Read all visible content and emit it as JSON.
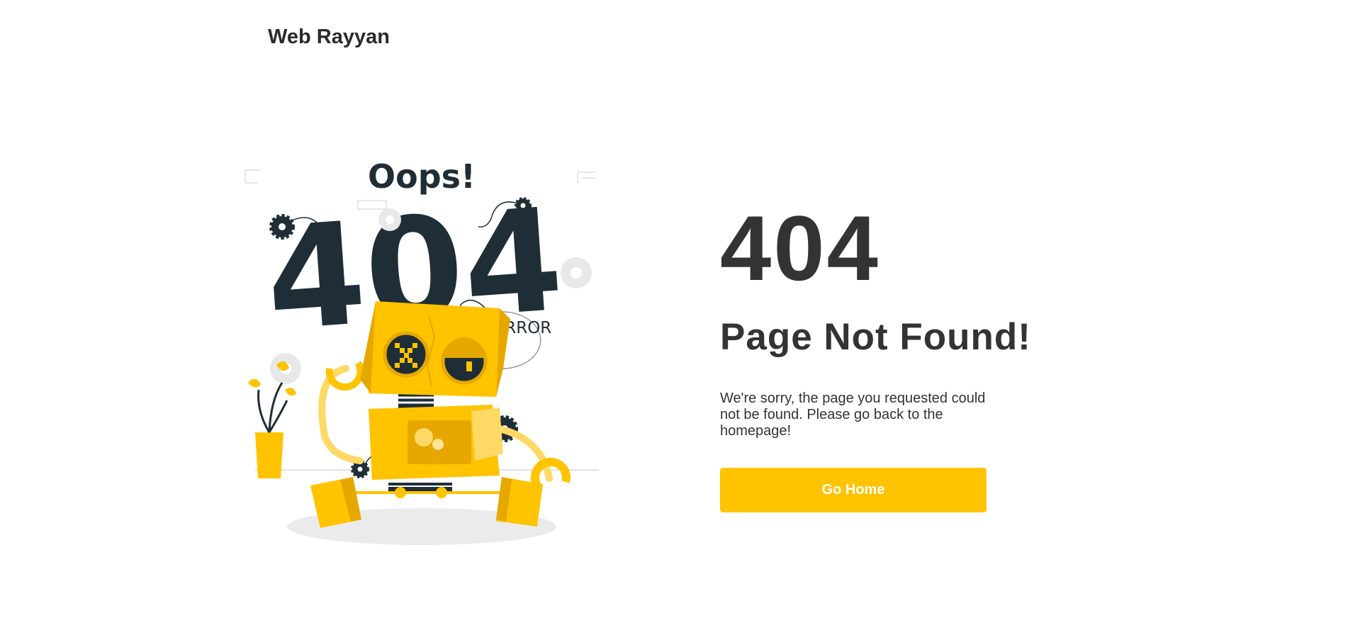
{
  "header": {
    "brand": "Web Rayyan"
  },
  "illustration": {
    "oops_text": "Oops!",
    "code_text": "404",
    "bubble_text": "ERROR",
    "icon": "robot-404-illustration"
  },
  "main": {
    "code": "404",
    "title": "Page Not Found!",
    "message": "We're sorry, the page you requested could not be found. Please go back to the homepage!",
    "button_label": "Go Home"
  },
  "colors": {
    "accent": "#ffc300",
    "text": "#333333",
    "illustration_dark": "#1f2d36",
    "illustration_gray": "#ebebeb"
  }
}
